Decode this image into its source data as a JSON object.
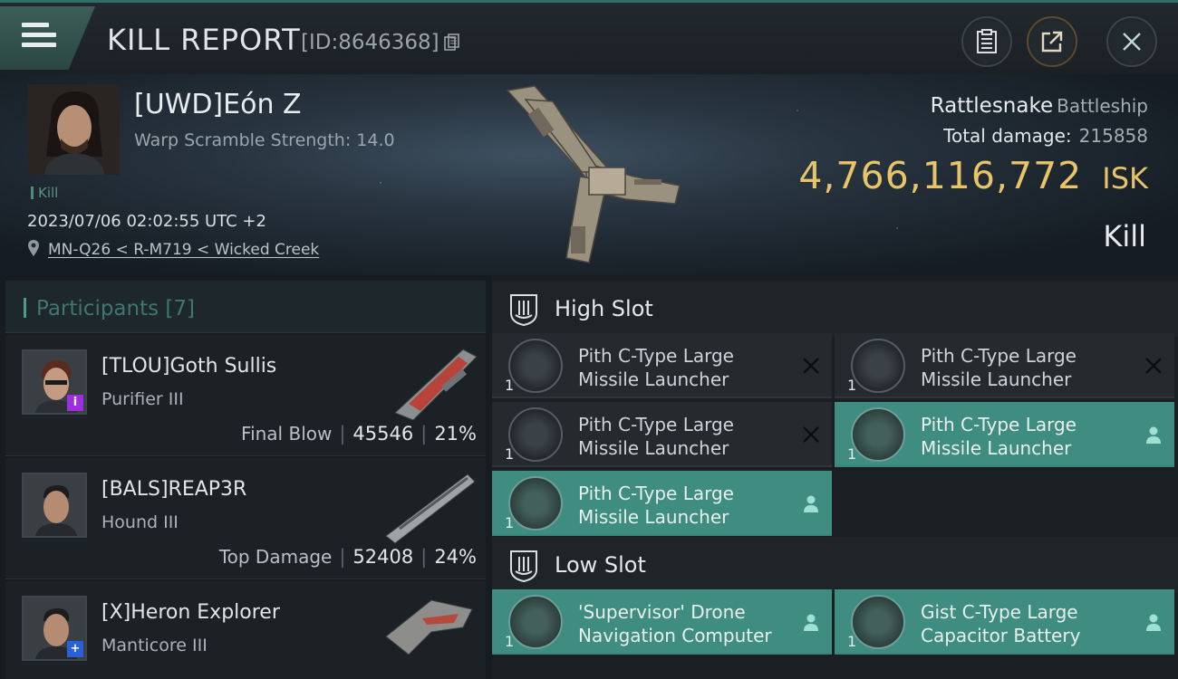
{
  "header": {
    "title": "KILL REPORT",
    "id_label": "[ID:8646368]"
  },
  "victim": {
    "name": "[UWD]Eón Z",
    "warp_scramble": "Warp Scramble Strength: 14.0",
    "tag": "Kill",
    "datetime": "2023/07/06 02:02:55 UTC +2",
    "location": "MN-Q26 < R-M719 < Wicked Creek",
    "ship_name": "Rattlesnake",
    "ship_class": "Battleship",
    "total_damage_label": "Total damage:",
    "total_damage": "215858",
    "isk_value": "4,766,116,772",
    "isk_unit": "ISK",
    "result": "Kill"
  },
  "participants": {
    "title": "Participants [7]",
    "rows": [
      {
        "name": "[TLOU]Goth Sullis",
        "ship": "Purifier III",
        "label": "Final Blow",
        "damage": "45546",
        "percent": "21%",
        "badge": "i"
      },
      {
        "name": "[BALS]REAP3R",
        "ship": "Hound III",
        "label": "Top Damage",
        "damage": "52408",
        "percent": "24%",
        "badge": ""
      },
      {
        "name": "[X]Heron Explorer",
        "ship": "Manticore III",
        "label": "",
        "damage": "",
        "percent": "",
        "badge": "+"
      }
    ]
  },
  "slots": {
    "high": {
      "title": "High Slot",
      "modules": [
        {
          "name": "Pith C-Type Large Missile Launcher",
          "qty": "1",
          "state": "destroyed"
        },
        {
          "name": "Pith C-Type Large Missile Launcher",
          "qty": "1",
          "state": "destroyed"
        },
        {
          "name": "Pith C-Type Large Missile Launcher",
          "qty": "1",
          "state": "destroyed"
        },
        {
          "name": "Pith C-Type Large Missile Launcher",
          "qty": "1",
          "state": "dropped"
        },
        {
          "name": "Pith C-Type Large Missile Launcher",
          "qty": "1",
          "state": "dropped"
        }
      ]
    },
    "low": {
      "title": "Low Slot",
      "modules": [
        {
          "name": "'Supervisor' Drone Navigation Computer",
          "qty": "1",
          "state": "dropped"
        },
        {
          "name": "Gist C-Type Large Capacitor Battery",
          "qty": "1",
          "state": "dropped"
        }
      ]
    }
  },
  "colors": {
    "accent_teal": "#3e8d80",
    "isk_gold": "#e7c46a",
    "badge_purple": "#9b2fe0",
    "badge_blue": "#2a5fd6"
  }
}
